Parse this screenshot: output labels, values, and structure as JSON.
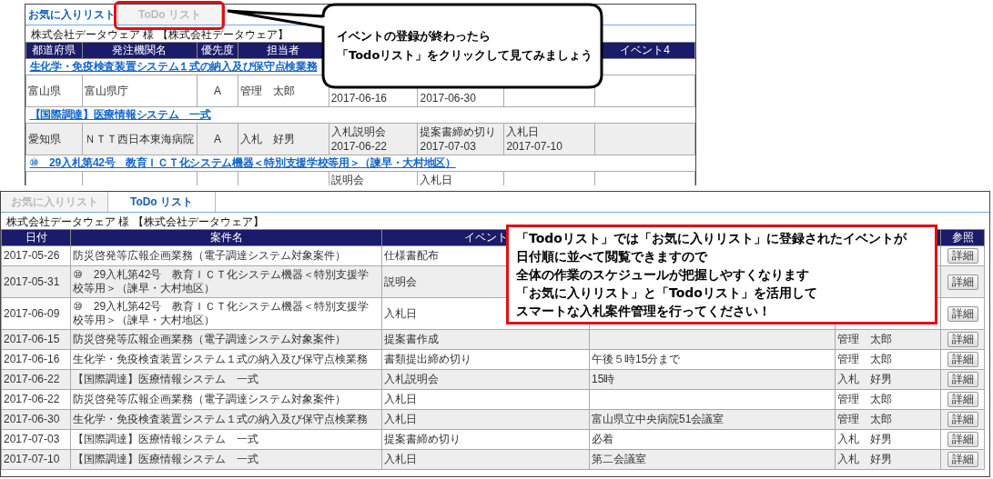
{
  "back_window": {
    "tabs": [
      {
        "label": "お気に入りリスト",
        "selected": true
      },
      {
        "label": "ToDo リスト",
        "selected": false
      }
    ],
    "account": "株式会社データウェア 様 【株式会社データウェア】",
    "columns": [
      {
        "label": "都道府県"
      },
      {
        "label": "発注機関名"
      },
      {
        "label": "優先度"
      },
      {
        "label": "担当者"
      },
      {},
      {},
      {},
      {
        "label": "イベント4"
      }
    ],
    "groups": [
      {
        "title": "生化学・免疫検査装置システム１式の納入及び保守点検業務",
        "row": {
          "prefecture": "富山県",
          "agency": "富山県庁",
          "priority": "A",
          "person": "管理　太郎",
          "event_1": {
            "date": "2017-06-16"
          },
          "event_2": {
            "date": "2017-06-30"
          }
        }
      },
      {
        "title": "【国際調達】医療情報システム　一式",
        "row": {
          "prefecture": "愛知県",
          "agency": "ＮＴＴ西日本東海病院",
          "priority": "A",
          "person": "入札　好男",
          "event_1": {
            "name": "入札説明会",
            "date": "2017-06-22"
          },
          "event_2": {
            "name": "提案書締め切り",
            "date": "2017-07-03"
          },
          "event_3": {
            "name": "入札日",
            "date": "2017-07-10"
          }
        }
      },
      {
        "title": "⑩　29入札第42号　教育ＩＣＴ化システム機器＜特別支援学校等用＞（諫早・大村地区）",
        "row": {
          "event_1": {
            "name": "説明会"
          },
          "event_2": {
            "name": "入札日"
          }
        }
      }
    ]
  },
  "front_window": {
    "tabs": [
      {
        "label": "お気に入りリスト",
        "selected": false
      },
      {
        "label": "ToDo リスト",
        "selected": true
      }
    ],
    "account": "株式会社データウェア 様 【株式会社データウェア】",
    "columns": [
      {
        "label": "日付"
      },
      {
        "label": "案件名"
      },
      {
        "label": "イベント"
      },
      {},
      {},
      {
        "label": "参照"
      }
    ],
    "rows": [
      {
        "date": "2017-05-26",
        "project": "防災啓発等広報企画業務（電子調達システム対象案件）",
        "event": "仕様書配布",
        "action": "詳細"
      },
      {
        "date": "2017-05-31",
        "project": "⑩　29入札第42号　教育ＩＣＴ化システム機器＜特別支援学校等用＞（諫早・大村地区）",
        "event": "説明会",
        "action": "詳細"
      },
      {
        "date": "2017-06-09",
        "project": "⑩　29入札第42号　教育ＩＣＴ化システム機器＜特別支援学校等用＞（諫早・大村地区）",
        "event": "入札日",
        "action": "詳細"
      },
      {
        "date": "2017-06-15",
        "project": "防災啓発等広報企画業務（電子調達システム対象案件）",
        "event": "提案書作成",
        "person": "管理　太郎",
        "action": "詳細"
      },
      {
        "date": "2017-06-16",
        "project": "生化学・免疫検査装置システム１式の納入及び保守点検業務",
        "event": "書類提出締め切り",
        "note": "午後５時15分まで",
        "person": "管理　太郎",
        "action": "詳細"
      },
      {
        "date": "2017-06-22",
        "project": "【国際調達】医療情報システム　一式",
        "event": "入札説明会",
        "note": "15時",
        "person": "入札　好男",
        "action": "詳細"
      },
      {
        "date": "2017-06-22",
        "project": "防災啓発等広報企画業務（電子調達システム対象案件）",
        "event": "入札日",
        "person": "管理　太郎",
        "action": "詳細"
      },
      {
        "date": "2017-06-30",
        "project": "生化学・免疫検査装置システム１式の納入及び保守点検業務",
        "event": "入札日",
        "note": "富山県立中央病院51会議室",
        "person": "管理　太郎",
        "action": "詳細"
      },
      {
        "date": "2017-07-03",
        "project": "【国際調達】医療情報システム　一式",
        "event": "提案書締め切り",
        "note": "必着",
        "person": "入札　好男",
        "action": "詳細"
      },
      {
        "date": "2017-07-10",
        "project": "【国際調達】医療情報システム　一式",
        "event": "入札日",
        "note": "第二会議室",
        "person": "入札　好男",
        "action": "詳細"
      }
    ]
  },
  "callouts": [
    {
      "kind": "bubble",
      "lines": [
        "イベントの登録が終わったら",
        "「Todoリスト」をクリックして見てみましょう"
      ]
    },
    {
      "kind": "box",
      "lines": [
        "「Todoリスト」では「お気に入りリスト」に登録されたイベントが",
        "日付順に並べて閲覧できますので",
        "全体の作業のスケジュールが把握しやすくなります",
        "「お気に入りリスト」と「Todoリスト」を活用して",
        "スマートな入札案件管理を行ってください！"
      ]
    }
  ]
}
